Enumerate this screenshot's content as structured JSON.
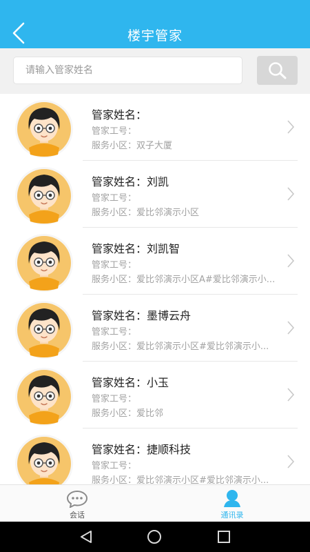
{
  "header": {
    "title": "楼宇管家",
    "back_icon": "back-arrow-icon"
  },
  "search": {
    "placeholder": "请输入管家姓名",
    "value": "",
    "button_icon": "search-icon"
  },
  "list": {
    "name_label": "管家姓名：",
    "id_label": "管家工号：",
    "community_label": "服务小区：",
    "items": [
      {
        "name": "",
        "id": "",
        "community": "双子大厦"
      },
      {
        "name": "刘凯",
        "id": "",
        "community": "爱比邻演示小区"
      },
      {
        "name": "刘凯智",
        "id": "",
        "community": "爱比邻演示小区A#爱比邻演示小..."
      },
      {
        "name": "墨博云舟",
        "id": "",
        "community": "爱比邻演示小区#爱比邻演示小..."
      },
      {
        "name": "小玉",
        "id": "",
        "community": "爱比邻"
      },
      {
        "name": "捷顺科技",
        "id": "",
        "community": "爱比邻演示小区#爱比邻演示小..."
      }
    ]
  },
  "tabs": [
    {
      "label": "会话",
      "icon": "chat-bubble-icon",
      "active": false
    },
    {
      "label": "通讯录",
      "icon": "contacts-person-icon",
      "active": true
    }
  ],
  "colors": {
    "primary": "#2fb6ee",
    "inactive": "#555555"
  },
  "system_nav": {
    "icons": [
      "back-triangle-icon",
      "home-circle-icon",
      "recents-square-icon"
    ]
  }
}
